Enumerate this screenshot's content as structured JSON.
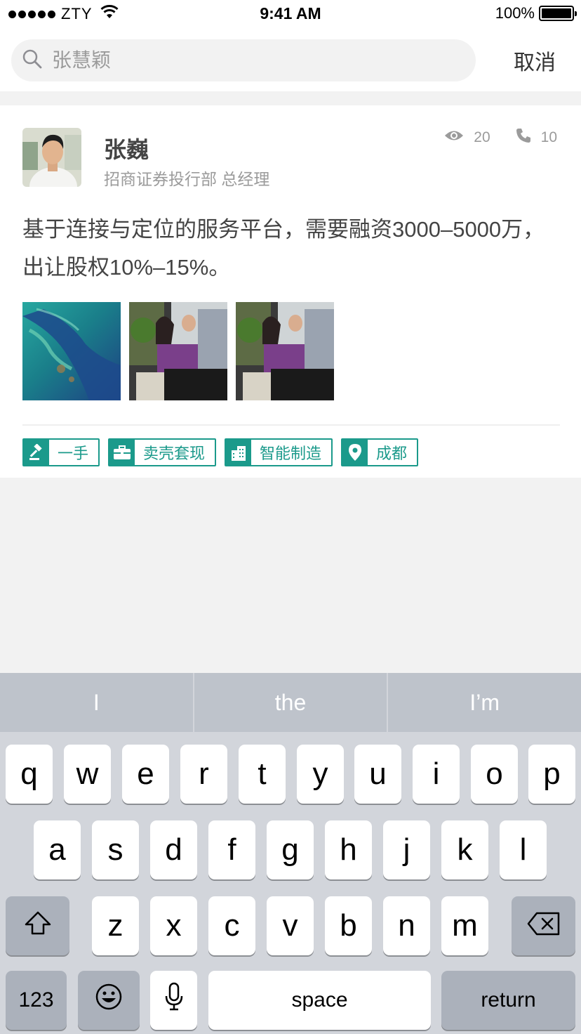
{
  "status_bar": {
    "carrier": "ZTY",
    "time": "9:41 AM",
    "battery": "100%"
  },
  "search": {
    "placeholder": "张慧颖",
    "cancel_label": "取消"
  },
  "card": {
    "name": "张巍",
    "title": "招商证券投行部 总经理",
    "views": "20",
    "calls": "10",
    "description": "基于连接与定位的服务平台，需要融资3000–5000万，出让股权10%–15%。",
    "tags": [
      {
        "label": "一手",
        "icon": "gavel-icon"
      },
      {
        "label": "卖壳套现",
        "icon": "briefcase-icon"
      },
      {
        "label": "智能制造",
        "icon": "building-icon"
      },
      {
        "label": "成都",
        "icon": "location-pin-icon"
      }
    ],
    "accent_color": "#1b9a8b"
  },
  "keyboard": {
    "predictions": [
      "I",
      "the",
      "I’m"
    ],
    "row1": [
      "q",
      "w",
      "e",
      "r",
      "t",
      "y",
      "u",
      "i",
      "o",
      "p"
    ],
    "row2": [
      "a",
      "s",
      "d",
      "f",
      "g",
      "h",
      "j",
      "k",
      "l"
    ],
    "row3": [
      "z",
      "x",
      "c",
      "v",
      "b",
      "n",
      "m"
    ],
    "numbers_label": "123",
    "space_label": "space",
    "return_label": "return"
  }
}
